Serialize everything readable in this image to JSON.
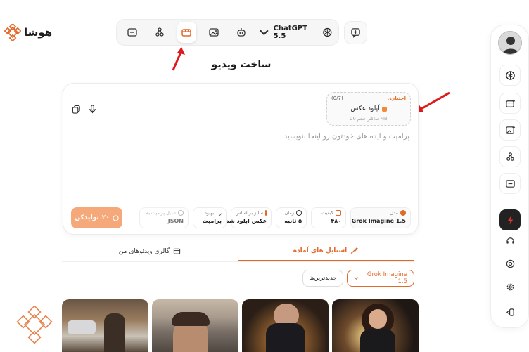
{
  "brand": {
    "name": "هوشا",
    "accent": "#e06a2a"
  },
  "topbar": {
    "model_label": "ChatGPT 5.5",
    "icons": [
      "folder-icon",
      "network-icon",
      "video-icon",
      "image-icon",
      "robot-icon"
    ],
    "active": "video-icon"
  },
  "page": {
    "title": "ساخت ویدیو"
  },
  "upload": {
    "optional_label": "اختیاری",
    "count": "(0/7)",
    "label": "آپلود عکس",
    "hint": "حداکثر حجم 20MB"
  },
  "prompt": {
    "placeholder": "پرامپت و ایده های خودتون رو اینجا بنویسید"
  },
  "options": {
    "model": {
      "label": "مدل",
      "value": "Grok Imagine 1.5"
    },
    "quality": {
      "label": "کیفیت",
      "value": "۴۸۰"
    },
    "time": {
      "label": "زمان",
      "value": "۵ ثانیه"
    },
    "size": {
      "label": "سایز بر اساس",
      "value": "عکس اپلود شده"
    },
    "enhance": {
      "label": "بهبود",
      "value": "پرامپت"
    },
    "json": {
      "label": "تبدیل پرامپت به",
      "value": "JSON"
    }
  },
  "generate_button": {
    "label": "تولیدکن",
    "cost": "۲۰"
  },
  "tabs": [
    {
      "label": "استایل های آماده",
      "active": true
    },
    {
      "label": "گالری ویدئوهای من",
      "active": false
    }
  ],
  "filters": {
    "model": "Grok Imagine 1.5",
    "sort": "جدیدترین‌ها"
  }
}
